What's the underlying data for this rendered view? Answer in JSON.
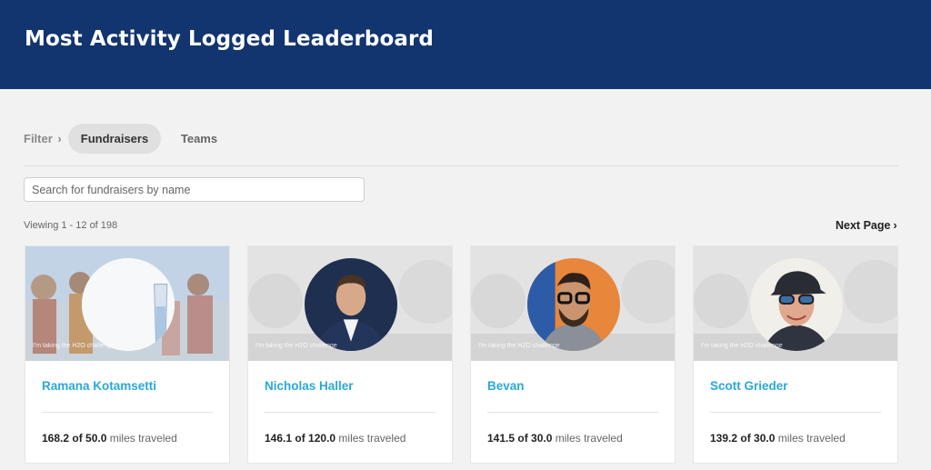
{
  "header": {
    "title": "Most Activity Logged Leaderboard"
  },
  "filter": {
    "label": "Filter",
    "chevron": "›",
    "tabs": [
      {
        "label": "Fundraisers",
        "active": true
      },
      {
        "label": "Teams",
        "active": false
      }
    ]
  },
  "search": {
    "placeholder": "Search for fundraisers by name",
    "value": ""
  },
  "pagination": {
    "viewing": "Viewing 1 - 12 of 198",
    "next_label": "Next Page",
    "chevron": "›"
  },
  "colors": {
    "header_bg": "#12346f",
    "name_link": "#2aa8d8",
    "background": "#f2f2f2"
  },
  "cards": [
    {
      "name": "Ramana Kotamsetti",
      "miles": "168.2",
      "of_label": "of",
      "goal": "50.0",
      "unit": "miles traveled",
      "banner_text": "I'm taking the H2O challenge",
      "avatar_icon": "water-glass-icon"
    },
    {
      "name": "Nicholas Haller",
      "miles": "146.1",
      "of_label": "of",
      "goal": "120.0",
      "unit": "miles traveled",
      "banner_text": "I'm taking the H2O challenge",
      "avatar_icon": "profile-photo"
    },
    {
      "name": "Bevan",
      "miles": "141.5",
      "of_label": "of",
      "goal": "30.0",
      "unit": "miles traveled",
      "banner_text": "I'm taking the H2O challenge",
      "avatar_icon": "profile-photo"
    },
    {
      "name": "Scott Grieder",
      "miles": "139.2",
      "of_label": "of",
      "goal": "30.0",
      "unit": "miles traveled",
      "banner_text": "I'm taking the H2O challenge",
      "avatar_icon": "profile-photo"
    }
  ]
}
